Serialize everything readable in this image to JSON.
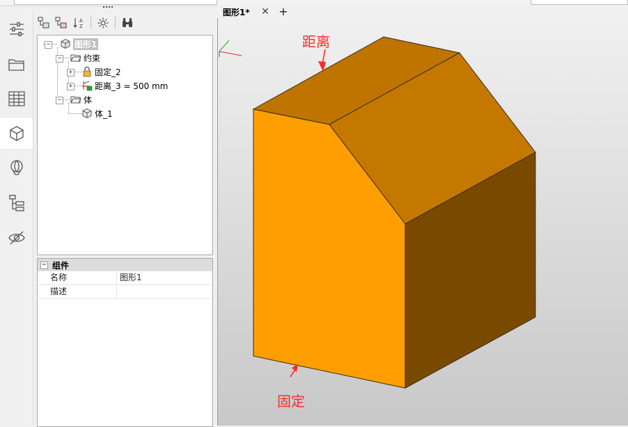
{
  "document_tab": {
    "title": "图形1*",
    "close_icon": "close-icon",
    "add_icon": "plus-icon"
  },
  "sidebar": {
    "items": [
      {
        "name": "sliders-icon"
      },
      {
        "name": "folder-icon"
      },
      {
        "name": "table-icon"
      },
      {
        "name": "cube-icon",
        "active": true
      },
      {
        "name": "balloon-icon"
      },
      {
        "name": "hierarchy-icon"
      },
      {
        "name": "eye-off-icon"
      }
    ]
  },
  "browser_toolbar": [
    "expand-tree-icon",
    "collapse-tree-icon",
    "sort-az-icon",
    "settings-icon",
    "find-icon"
  ],
  "tree": {
    "root": "图形1",
    "constraints_folder": "约束",
    "constraint_fixed": "固定_2",
    "constraint_distance": "距离_3 = 500 mm",
    "bodies_folder": "体",
    "body": "体_1"
  },
  "properties": {
    "section": "组件",
    "rows": [
      {
        "key": "名称",
        "value": "图形1"
      },
      {
        "key": "描述",
        "value": ""
      }
    ]
  },
  "annotations": {
    "top": "距离",
    "bottom": "固定"
  },
  "colors": {
    "front_face": "#ff9e00",
    "top_face": "#c77800",
    "side_face": "#7a4900",
    "annotation": "#ff2a2a",
    "selection_bg": "#bfbfbf"
  }
}
